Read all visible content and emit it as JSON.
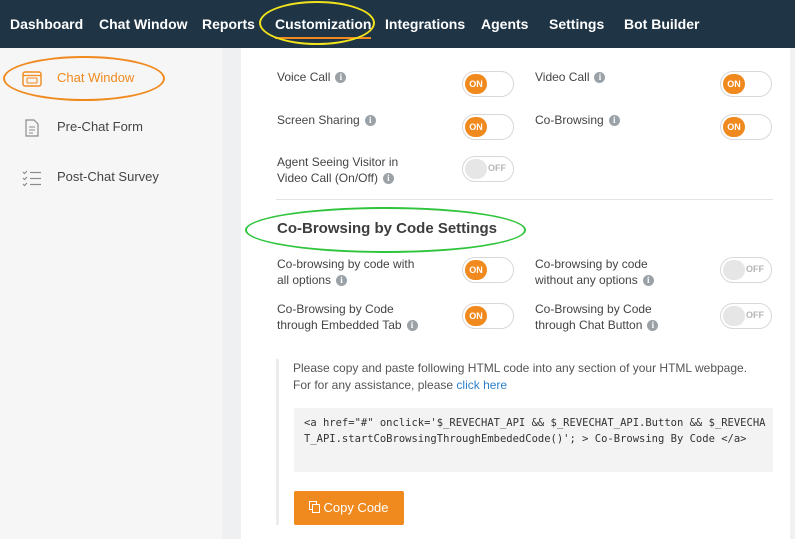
{
  "topnav": {
    "items": [
      {
        "label": "Dashboard"
      },
      {
        "label": "Chat Window"
      },
      {
        "label": "Reports"
      },
      {
        "label": "Customization",
        "active": true
      },
      {
        "label": "Integrations"
      },
      {
        "label": "Agents"
      },
      {
        "label": "Settings"
      },
      {
        "label": "Bot Builder"
      }
    ]
  },
  "sidebar": {
    "items": [
      {
        "label": "Chat Window",
        "icon": "chat-window-icon",
        "active": true
      },
      {
        "label": "Pre-Chat Form",
        "icon": "document-icon"
      },
      {
        "label": "Post-Chat Survey",
        "icon": "checklist-icon"
      }
    ]
  },
  "settings": {
    "voice_call": {
      "label": "Voice Call",
      "state": "ON"
    },
    "video_call": {
      "label": "Video Call",
      "state": "ON"
    },
    "screen_sharing": {
      "label": "Screen Sharing",
      "state": "ON"
    },
    "co_browsing": {
      "label": "Co-Browsing",
      "state": "ON"
    },
    "agent_seeing": {
      "label_line1": "Agent Seeing Visitor in",
      "label_line2": "Video Call (On/Off)",
      "state": "OFF"
    }
  },
  "cobrowsing_section": {
    "title": "Co-Browsing by Code Settings",
    "all_options": {
      "label_line1": "Co-browsing by code with",
      "label_line2": "all options",
      "state": "ON"
    },
    "without_options": {
      "label_line1": "Co-browsing by code",
      "label_line2": "without any options",
      "state": "OFF"
    },
    "embedded_tab": {
      "label_line1": "Co-Browsing by Code",
      "label_line2": "through Embedded Tab",
      "state": "ON"
    },
    "chat_button": {
      "label_line1": "Co-Browsing by Code",
      "label_line2": "through Chat Button",
      "state": "OFF"
    }
  },
  "instructions": {
    "text1": "Please copy and paste following HTML code into any section of your HTML webpage.",
    "text2": "For for any assistance, please ",
    "link": "click here"
  },
  "code_snippet": " <a href=\"#\" onclick='$_REVECHAT_API && $_REVECHAT_API.Button && $_REVECHAT_API.startCoBrowsingThroughEmbededCode()'; > Co-Browsing By Code </a>",
  "copy_button": {
    "label": "Copy Code",
    "icon": "copy-icon"
  },
  "colors": {
    "accent": "#f08a1f",
    "nav_bg": "#1f3546",
    "highlight_yellow": "#f1e21b",
    "highlight_green": "#2ec43b"
  }
}
